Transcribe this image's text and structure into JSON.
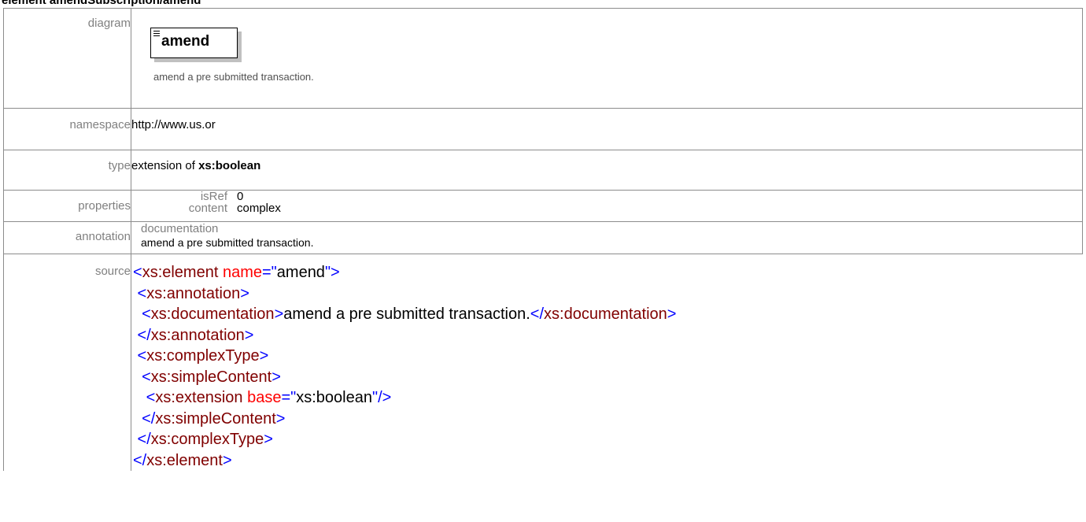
{
  "heading": "element amendSubscription/amend",
  "rows": {
    "diagram": {
      "label": "diagram",
      "element_name": "amend",
      "note": "amend a pre submitted transaction."
    },
    "namespace": {
      "label": "namespace",
      "value": "http://www.us.or"
    },
    "type": {
      "label": "type",
      "prefix": "extension of ",
      "base": "xs:boolean"
    },
    "properties": {
      "label": "properties",
      "items": [
        {
          "key": "isRef",
          "value": "0"
        },
        {
          "key": "content",
          "value": "complex"
        }
      ]
    },
    "annotation": {
      "label": "annotation",
      "doc_key": "documentation",
      "doc_value": "amend a pre submitted transaction."
    },
    "source": {
      "label": "source",
      "lines": [
        [
          {
            "t": "<",
            "c": "t"
          },
          {
            "t": "xs:element",
            "c": "n"
          },
          {
            "t": " name",
            "c": "a"
          },
          {
            "t": "=\"",
            "c": "t"
          },
          {
            "t": "amend",
            "c": "x"
          },
          {
            "t": "\">",
            "c": "t"
          }
        ],
        [
          {
            "t": " <",
            "c": "t"
          },
          {
            "t": "xs:annotation",
            "c": "n"
          },
          {
            "t": ">",
            "c": "t"
          }
        ],
        [
          {
            "t": "  <",
            "c": "t"
          },
          {
            "t": "xs:documentation",
            "c": "n"
          },
          {
            "t": ">",
            "c": "t"
          },
          {
            "t": "amend a pre submitted transaction.",
            "c": "x"
          },
          {
            "t": "</",
            "c": "t"
          },
          {
            "t": "xs:documentation",
            "c": "n"
          },
          {
            "t": ">",
            "c": "t"
          }
        ],
        [
          {
            "t": " </",
            "c": "t"
          },
          {
            "t": "xs:annotation",
            "c": "n"
          },
          {
            "t": ">",
            "c": "t"
          }
        ],
        [
          {
            "t": " <",
            "c": "t"
          },
          {
            "t": "xs:complexType",
            "c": "n"
          },
          {
            "t": ">",
            "c": "t"
          }
        ],
        [
          {
            "t": "  <",
            "c": "t"
          },
          {
            "t": "xs:simpleContent",
            "c": "n"
          },
          {
            "t": ">",
            "c": "t"
          }
        ],
        [
          {
            "t": "   <",
            "c": "t"
          },
          {
            "t": "xs:extension",
            "c": "n"
          },
          {
            "t": " base",
            "c": "a"
          },
          {
            "t": "=\"",
            "c": "t"
          },
          {
            "t": "xs:boolean",
            "c": "x"
          },
          {
            "t": "\"/>",
            "c": "t"
          }
        ],
        [
          {
            "t": "  </",
            "c": "t"
          },
          {
            "t": "xs:simpleContent",
            "c": "n"
          },
          {
            "t": ">",
            "c": "t"
          }
        ],
        [
          {
            "t": " </",
            "c": "t"
          },
          {
            "t": "xs:complexType",
            "c": "n"
          },
          {
            "t": ">",
            "c": "t"
          }
        ],
        [
          {
            "t": "</",
            "c": "t"
          },
          {
            "t": "xs:element",
            "c": "n"
          },
          {
            "t": ">",
            "c": "t"
          }
        ]
      ]
    }
  },
  "colors": {
    "tag_punct": "#0000ff",
    "tag_name": "#800000",
    "attr_name": "#ff0000",
    "label_grey": "#808080",
    "border": "#8c8c8c"
  }
}
